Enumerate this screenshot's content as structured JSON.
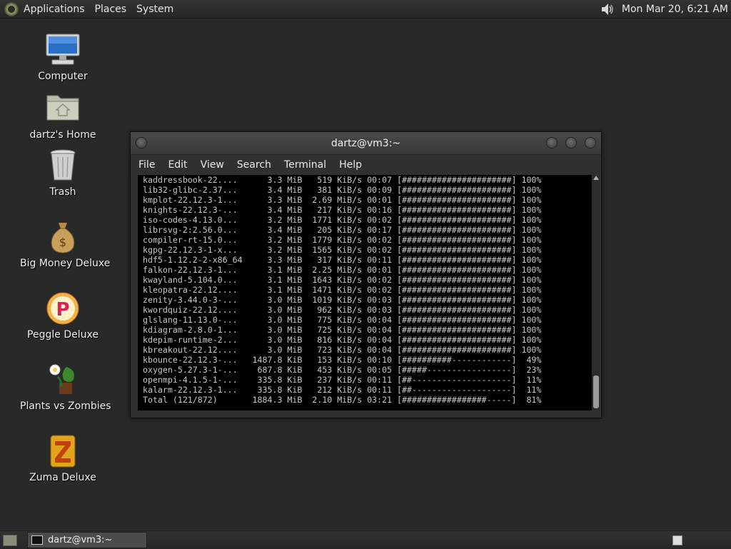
{
  "top_panel": {
    "menus": [
      "Applications",
      "Places",
      "System"
    ],
    "clock": "Mon Mar 20,  6:21 AM"
  },
  "desktop": {
    "icons": [
      {
        "label": "Computer",
        "icon": "computer-icon"
      },
      {
        "label": "dartz's Home",
        "icon": "home-folder-icon"
      },
      {
        "label": "Trash",
        "icon": "trash-icon"
      },
      {
        "label": "Big Money Deluxe",
        "icon": "money-bag-icon"
      },
      {
        "label": "Peggle Deluxe",
        "icon": "peggle-icon"
      },
      {
        "label": "Plants vs Zombies",
        "icon": "plants-icon"
      },
      {
        "label": "Zuma Deluxe",
        "icon": "zuma-icon"
      }
    ]
  },
  "window": {
    "title": "dartz@vm3:~",
    "menu": [
      "File",
      "Edit",
      "View",
      "Search",
      "Terminal",
      "Help"
    ],
    "terminal_lines": [
      " kaddressbook-22....      3.3 MiB   519 KiB/s 00:07 [######################] 100%",
      " lib32-glibc-2.37...      3.4 MiB   381 KiB/s 00:09 [######################] 100%",
      " kmplot-22.12.3-1...      3.3 MiB  2.69 MiB/s 00:01 [######################] 100%",
      " knights-22.12.3-...      3.4 MiB   217 KiB/s 00:16 [######################] 100%",
      " iso-codes-4.13.0...      3.2 MiB  1771 KiB/s 00:02 [######################] 100%",
      " librsvg-2:2.56.0...      3.4 MiB   205 KiB/s 00:17 [######################] 100%",
      " compiler-rt-15.0...      3.2 MiB  1779 KiB/s 00:02 [######################] 100%",
      " kgpg-22.12.3-1-x...      3.2 MiB  1565 KiB/s 00:02 [######################] 100%",
      " hdf5-1.12.2-2-x86_64     3.3 MiB   317 KiB/s 00:11 [######################] 100%",
      " falkon-22.12.3-1...      3.1 MiB  2.25 MiB/s 00:01 [######################] 100%",
      " kwayland-5.104.0...      3.1 MiB  1643 KiB/s 00:02 [######################] 100%",
      " kleopatra-22.12....      3.1 MiB  1471 KiB/s 00:02 [######################] 100%",
      " zenity-3.44.0-3-...      3.0 MiB  1019 KiB/s 00:03 [######################] 100%",
      " kwordquiz-22.12....      3.0 MiB   962 KiB/s 00:03 [######################] 100%",
      " glslang-11.13.0-...      3.0 MiB   775 KiB/s 00:04 [######################] 100%",
      " kdiagram-2.8.0-1...      3.0 MiB   725 KiB/s 00:04 [######################] 100%",
      " kdepim-runtime-2...      3.0 MiB   816 KiB/s 00:04 [######################] 100%",
      " kbreakout-22.12....      3.0 MiB   723 KiB/s 00:04 [######################] 100%",
      " kbounce-22.12.3-...   1487.8 KiB   153 KiB/s 00:10 [##########------------]  49%",
      " oxygen-5.27.3-1-...    687.8 KiB   453 KiB/s 00:05 [#####-----------------]  23%",
      " openmpi-4.1.5-1-...    335.8 KiB   237 KiB/s 00:11 [##--------------------]  11%",
      " kalarm-22.12.3-1...    335.8 KiB   212 KiB/s 00:11 [##--------------------]  11%",
      " Total (121/872)       1884.3 MiB  2.10 MiB/s 03:21 [#################-----]  81%"
    ]
  },
  "taskbar": {
    "task_label": "dartz@vm3:~"
  }
}
